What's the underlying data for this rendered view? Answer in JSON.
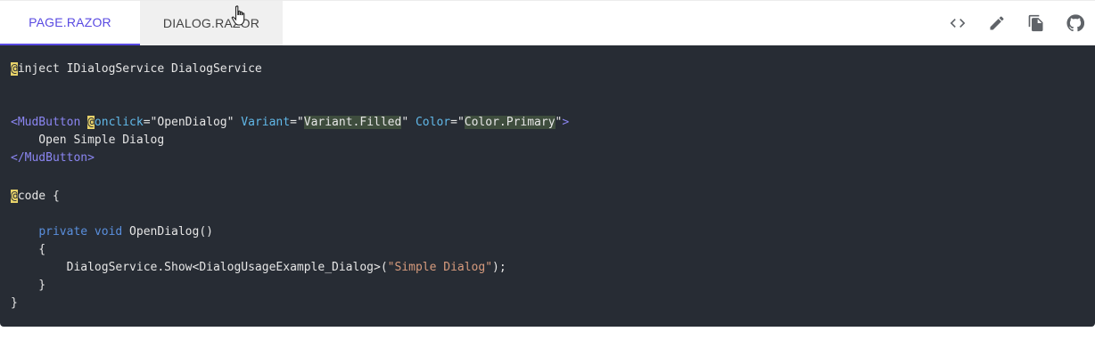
{
  "tabs": {
    "page": "PAGE.RAZOR",
    "dialog": "DIALOG.RAZOR"
  },
  "actions": [
    "code-icon",
    "edit-icon",
    "copy-icon",
    "github-icon"
  ],
  "code": {
    "l1_at": "@",
    "l1_rest": "inject IDialogService DialogService",
    "l2_open": "<MudButton ",
    "l2_at": "@",
    "l2_attr1": "onclick",
    "l2_eq1": "=\"OpenDialog\" ",
    "l2_attr2": "Variant",
    "l2_eq2": "=\"",
    "l2_val2": "Variant.Filled",
    "l2_q2": "\" ",
    "l2_attr3": "Color",
    "l2_eq3": "=\"",
    "l2_val3": "Color.Primary",
    "l2_q3": "\"",
    "l2_close": ">",
    "l3": "    Open Simple Dialog",
    "l4": "</MudButton>",
    "l5_at": "@",
    "l5_rest": "code {",
    "l6_indent": "    ",
    "l6_kw": "private void",
    "l6_rest": " OpenDialog()",
    "l7": "    {",
    "l8_pre": "        DialogService.Show<DialogUsageExample_Dialog>(",
    "l8_str": "\"Simple Dialog\"",
    "l8_post": ");",
    "l9": "    }",
    "l10": "}"
  },
  "colors": {
    "accent": "#594ae2",
    "code_bg": "#272c34",
    "tag": "#8b86f2",
    "attribute": "#61b8e8",
    "keyword": "#5a8fdd",
    "string_literal": "#d79b7d",
    "directive_highlight": "#e8d36a"
  }
}
